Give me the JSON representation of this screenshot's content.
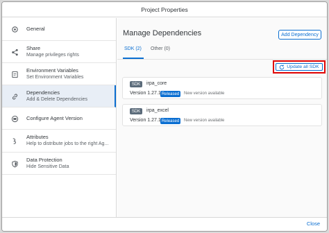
{
  "dialog": {
    "title": "Project Properties"
  },
  "sidebar": {
    "items": [
      {
        "title": "General",
        "subtitle": "",
        "icon": "settings-icon"
      },
      {
        "title": "Share",
        "subtitle": "Manage privileges rights",
        "icon": "share-icon"
      },
      {
        "title": "Environment Variables",
        "subtitle": "Set Environment Variables",
        "icon": "variables-icon"
      },
      {
        "title": "Dependencies",
        "subtitle": "Add & Delete Dependencies",
        "icon": "link-icon"
      },
      {
        "title": "Configure Agent Version",
        "subtitle": "",
        "icon": "agent-icon"
      },
      {
        "title": "Attributes",
        "subtitle": "Help to distribute jobs to the right Ag...",
        "icon": "attributes-icon"
      },
      {
        "title": "Data Protection",
        "subtitle": "Hide Sensitive Data",
        "icon": "shield-icon"
      }
    ]
  },
  "main": {
    "title": "Manage Dependencies",
    "add_button": "Add Dependency",
    "tabs": [
      {
        "label": "SDK (2)"
      },
      {
        "label": "Other (0)"
      }
    ],
    "update_all_button": "Update all SDK",
    "dependencies": [
      {
        "badge": "SDK",
        "name": "irpa_core",
        "version": "Version 1.27.12",
        "status": "Released",
        "note": "New version available"
      },
      {
        "badge": "SDK",
        "name": "irpa_excel",
        "version": "Version 1.27.12",
        "status": "Released",
        "note": "New version available"
      }
    ]
  },
  "footer": {
    "close_label": "Close"
  },
  "colors": {
    "accent": "#0a6ed1",
    "highlight_border": "#e00000",
    "badge_gray": "#5b6b7a"
  }
}
